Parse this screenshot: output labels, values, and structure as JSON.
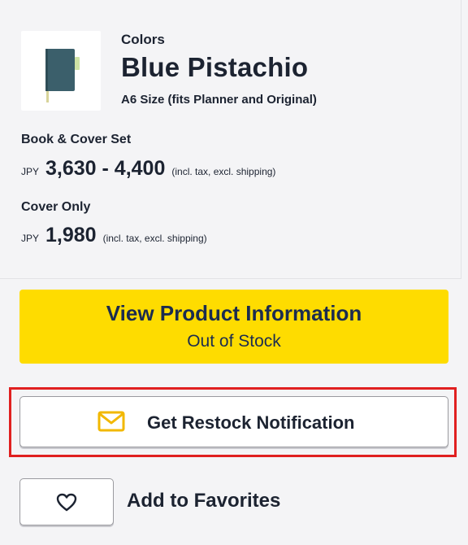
{
  "product": {
    "colors_label": "Colors",
    "name": "Blue Pistachio",
    "size_note": "A6 Size (fits Planner and Original)",
    "thumbnail_icon": "notebook-icon"
  },
  "pricing": {
    "book_cover_set": {
      "label": "Book & Cover Set",
      "currency": "JPY",
      "amount": "3,630 - 4,400",
      "tax_note": "(incl. tax, excl. shipping)"
    },
    "cover_only": {
      "label": "Cover Only",
      "currency": "JPY",
      "amount": "1,980",
      "tax_note": "(incl. tax, excl. shipping)"
    }
  },
  "actions": {
    "view_product": {
      "label": "View Product Information",
      "sublabel": "Out of Stock"
    },
    "restock": {
      "label": "Get Restock Notification",
      "icon": "mail-icon"
    },
    "favorites": {
      "label": "Add to Favorites",
      "icon": "heart-icon"
    }
  },
  "colors": {
    "accent_yellow": "#fedc00",
    "button_text_navy": "#1b2c4f",
    "highlight_red": "#e02020",
    "notebook_blue": "#3b5f6b"
  }
}
